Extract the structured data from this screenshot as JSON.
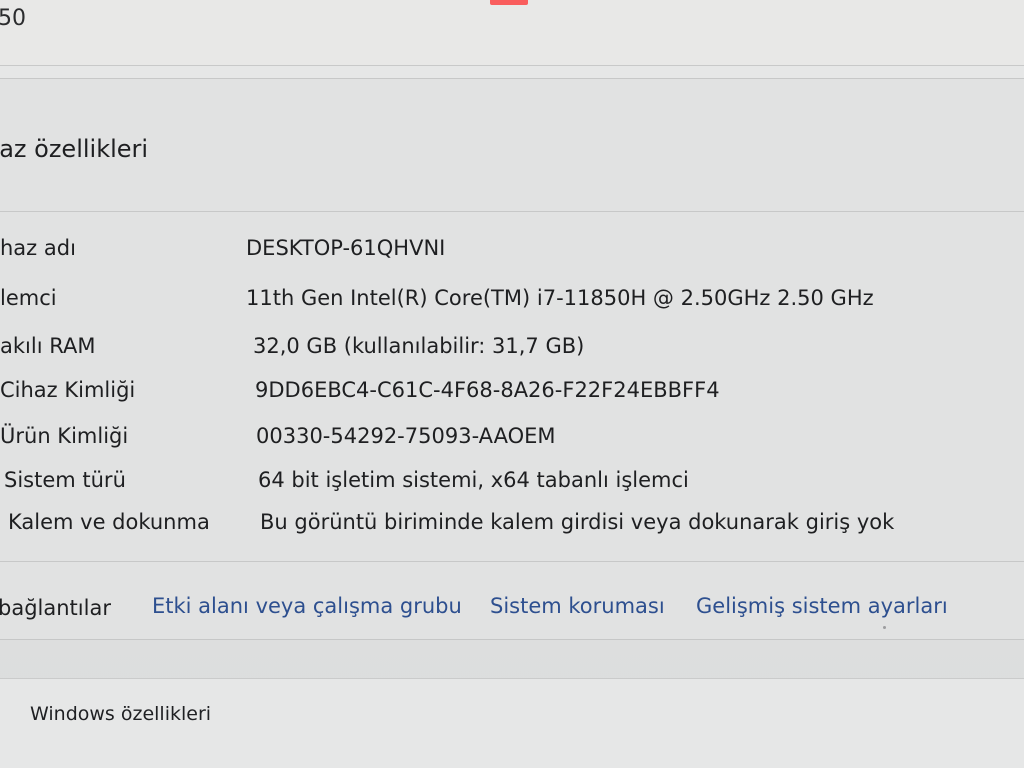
{
  "top": {
    "number": "50"
  },
  "device_specs": {
    "title": "haz özellikleri",
    "rows": [
      {
        "label": "haz adı",
        "value": "DESKTOP-61QHVNI"
      },
      {
        "label": "lemci",
        "value": "11th Gen Intel(R) Core(TM) i7-11850H @ 2.50GHz   2.50 GHz"
      },
      {
        "label": "akılı RAM",
        "value": "32,0 GB (kullanılabilir: 31,7 GB)"
      },
      {
        "label": "Cihaz Kimliği",
        "value": "9DD6EBC4-C61C-4F68-8A26-F22F24EBBFF4"
      },
      {
        "label": "Ürün Kimliği",
        "value": "00330-54292-75093-AAOEM"
      },
      {
        "label": "Sistem türü",
        "value": "64 bit işletim sistemi, x64 tabanlı işlemci"
      },
      {
        "label": "Kalem ve dokunma",
        "value": "Bu görüntü biriminde kalem girdisi veya dokunarak giriş yok"
      }
    ]
  },
  "related_links": {
    "label": "bağlantılar",
    "items": [
      "Etki alanı veya çalışma grubu",
      "Sistem koruması",
      "Gelişmiş sistem ayarları"
    ]
  },
  "windows_specs": {
    "title": "Windows özellikleri"
  },
  "colors": {
    "background": "#e1e2e2",
    "text": "#1e1f21",
    "link": "#2d4f8f",
    "divider": "#c7c8c8"
  }
}
